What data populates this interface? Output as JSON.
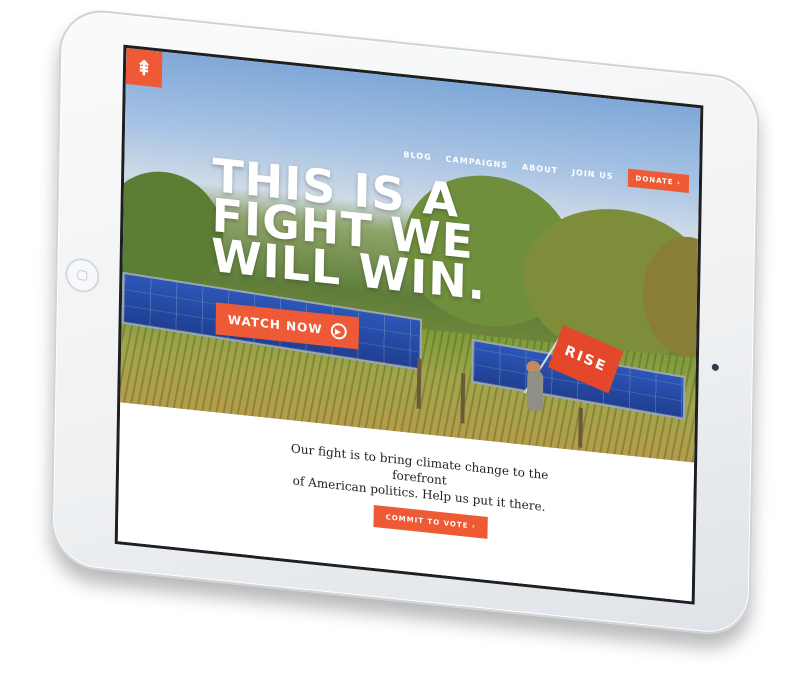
{
  "site": {
    "logo_icon": "tree-icon"
  },
  "nav": {
    "items": [
      "BLOG",
      "CAMPAIGNS",
      "ABOUT",
      "JOIN US"
    ],
    "donate": "DONATE ›"
  },
  "hero": {
    "headline_lines": [
      "THIS IS A",
      "FIGHT WE",
      "WILL WIN."
    ],
    "watch_label": "WATCH NOW",
    "flag_text": "RISE"
  },
  "lower": {
    "tagline_line1": "Our fight is to bring climate change to the forefront",
    "tagline_line2": "of American politics. Help us put it there.",
    "commit_label": "COMMIT TO VOTE ›"
  },
  "colors": {
    "accent": "#ee5a35"
  }
}
